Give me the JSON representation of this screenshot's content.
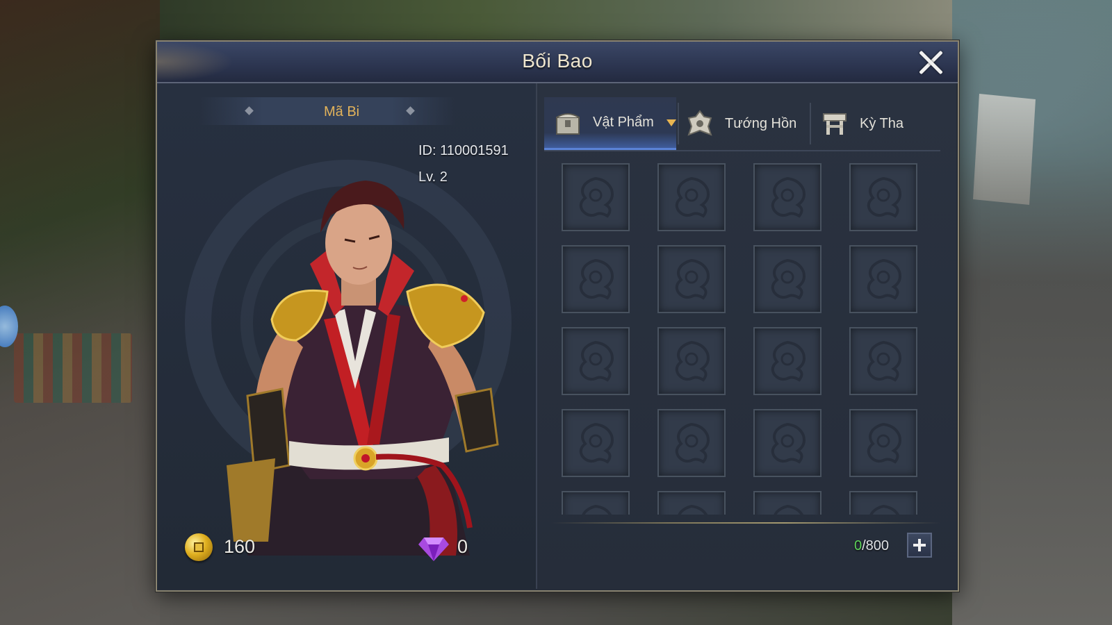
{
  "window": {
    "title": "Bối Bao"
  },
  "character": {
    "name": "Mã Bi",
    "id_label": "ID: 110001591",
    "level_label": "Lv. 2"
  },
  "currency": {
    "gold": "160",
    "gems": "0"
  },
  "tabs": [
    {
      "label": "Vật Phẩm",
      "icon": "chest-icon",
      "active": true
    },
    {
      "label": "Tướng Hồn",
      "icon": "spirit-icon",
      "active": false
    },
    {
      "label": "Kỳ Tha",
      "icon": "table-icon",
      "active": false
    }
  ],
  "inventory": {
    "used": "0",
    "capacity_suffix": "/800",
    "visible_slots": 20,
    "empty_slot_icon": "dragon-emblem-icon"
  },
  "colors": {
    "accent_gold": "#e3b35a",
    "tab_active": "#5b83d6",
    "capacity_used": "#5ed35a"
  }
}
